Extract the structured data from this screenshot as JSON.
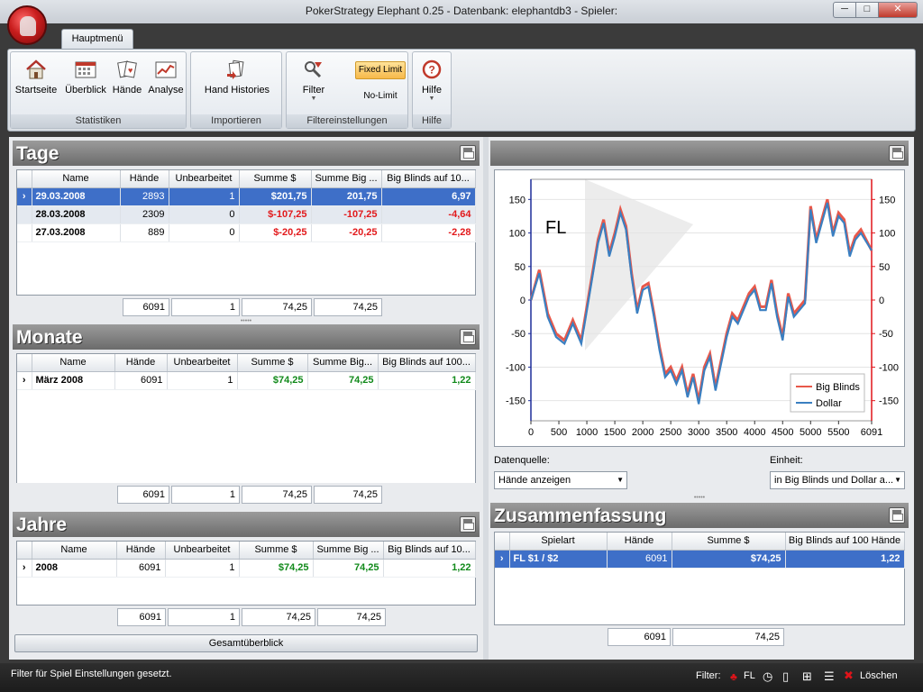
{
  "window": {
    "title": "PokerStrategy Elephant 0.25 - Datenbank: elephantdb3 - Spieler:",
    "min": "─",
    "max": "□",
    "close": "✕"
  },
  "ribbon": {
    "tab": "Hauptmenü",
    "groups": {
      "statistiken": "Statistiken",
      "importieren": "Importieren",
      "filter": "Filtereinstellungen",
      "hilfe": "Hilfe"
    },
    "buttons": {
      "startseite": "Startseite",
      "ueberblick": "Überblick",
      "haende": "Hände",
      "analyse": "Analyse",
      "hand_histories": "Hand Histories",
      "filter": "Filter",
      "fixed_limit": "Fixed Limit",
      "no_limit": "No-Limit",
      "hilfe": "Hilfe"
    }
  },
  "tage": {
    "title": "Tage",
    "columns": [
      "Name",
      "Hände",
      "Unbearbeitet",
      "Summe $",
      "Summe Big ...",
      "Big Blinds auf 10..."
    ],
    "rows": [
      {
        "name": "29.03.2008",
        "haende": "2893",
        "unbearbeitet": "1",
        "summe": "$201,75",
        "bb": "201,75",
        "bb100": "6,97"
      },
      {
        "name": "28.03.2008",
        "haende": "2309",
        "unbearbeitet": "0",
        "summe": "$-107,25",
        "bb": "-107,25",
        "bb100": "-4,64"
      },
      {
        "name": "27.03.2008",
        "haende": "889",
        "unbearbeitet": "0",
        "summe": "$-20,25",
        "bb": "-20,25",
        "bb100": "-2,28"
      }
    ],
    "totals": {
      "haende": "6091",
      "unbearbeitet": "1",
      "summe": "74,25",
      "bb": "74,25"
    }
  },
  "monate": {
    "title": "Monate",
    "columns": [
      "Name",
      "Hände",
      "Unbearbeitet",
      "Summe $",
      "Summe Big...",
      "Big Blinds auf 100..."
    ],
    "rows": [
      {
        "name": "März 2008",
        "haende": "6091",
        "unbearbeitet": "1",
        "summe": "$74,25",
        "bb": "74,25",
        "bb100": "1,22"
      }
    ],
    "totals": {
      "haende": "6091",
      "unbearbeitet": "1",
      "summe": "74,25",
      "bb": "74,25"
    }
  },
  "jahre": {
    "title": "Jahre",
    "columns": [
      "Name",
      "Hände",
      "Unbearbeitet",
      "Summe $",
      "Summe Big ...",
      "Big Blinds auf 10..."
    ],
    "rows": [
      {
        "name": "2008",
        "haende": "6091",
        "unbearbeitet": "1",
        "summe": "$74,25",
        "bb": "74,25",
        "bb100": "1,22"
      }
    ],
    "totals": {
      "haende": "6091",
      "unbearbeitet": "1",
      "summe": "74,25",
      "bb": "74,25"
    }
  },
  "gesamt_label": "Gesamtüberblick",
  "graph": {
    "datenquelle_label": "Datenquelle:",
    "datenquelle_value": "Hände anzeigen",
    "einheit_label": "Einheit:",
    "einheit_value": "in Big Blinds und Dollar a...",
    "colors": {
      "big_blinds": "#e8584a",
      "dollar": "#3a7fc1",
      "axis_right": "#e0141a",
      "axis_left": "#1f2f9a"
    }
  },
  "chart_data": {
    "type": "line",
    "annotation": "FL",
    "x_ticks": [
      "0",
      "500",
      "1000",
      "1500",
      "2000",
      "2500",
      "3000",
      "3500",
      "4000",
      "4500",
      "5000",
      "5500",
      "6091"
    ],
    "y_ticks_left": [
      "150",
      "100",
      "50",
      "0",
      "-50",
      "-100",
      "-150"
    ],
    "y_ticks_right": [
      "150",
      "100",
      "50",
      "0",
      "-50",
      "-100",
      "-150"
    ],
    "xlim": [
      0,
      6091
    ],
    "ylim": [
      -180,
      180
    ],
    "legend_position": "bottom-right",
    "series": [
      {
        "name": "Big Blinds",
        "x": [
          0,
          150,
          300,
          450,
          600,
          750,
          900,
          1000,
          1100,
          1200,
          1300,
          1400,
          1500,
          1600,
          1700,
          1800,
          1900,
          2000,
          2100,
          2200,
          2300,
          2400,
          2500,
          2600,
          2700,
          2800,
          2900,
          3000,
          3100,
          3200,
          3300,
          3400,
          3500,
          3600,
          3700,
          3800,
          3900,
          4000,
          4100,
          4200,
          4300,
          4400,
          4500,
          4600,
          4700,
          4800,
          4900,
          5000,
          5100,
          5200,
          5300,
          5400,
          5500,
          5600,
          5700,
          5800,
          5900,
          6091
        ],
        "values": [
          0,
          45,
          -20,
          -50,
          -60,
          -30,
          -60,
          -10,
          40,
          90,
          120,
          70,
          100,
          135,
          110,
          40,
          -15,
          20,
          25,
          -20,
          -70,
          -110,
          -100,
          -120,
          -100,
          -140,
          -110,
          -150,
          -100,
          -80,
          -130,
          -90,
          -50,
          -20,
          -30,
          -10,
          10,
          20,
          -10,
          -10,
          30,
          -20,
          -55,
          10,
          -20,
          -10,
          0,
          140,
          90,
          120,
          150,
          100,
          130,
          120,
          70,
          95,
          105,
          74
        ]
      },
      {
        "name": "Dollar",
        "x": [
          0,
          150,
          300,
          450,
          600,
          750,
          900,
          1000,
          1100,
          1200,
          1300,
          1400,
          1500,
          1600,
          1700,
          1800,
          1900,
          2000,
          2100,
          2200,
          2300,
          2400,
          2500,
          2600,
          2700,
          2800,
          2900,
          3000,
          3100,
          3200,
          3300,
          3400,
          3500,
          3600,
          3700,
          3800,
          3900,
          4000,
          4100,
          4200,
          4300,
          4400,
          4500,
          4600,
          4700,
          4800,
          4900,
          5000,
          5100,
          5200,
          5300,
          5400,
          5500,
          5600,
          5700,
          5800,
          5900,
          6091
        ],
        "values": [
          0,
          40,
          -25,
          -55,
          -65,
          -35,
          -65,
          -15,
          35,
          85,
          115,
          65,
          95,
          130,
          105,
          35,
          -20,
          15,
          20,
          -25,
          -75,
          -115,
          -105,
          -125,
          -105,
          -145,
          -115,
          -155,
          -105,
          -85,
          -135,
          -95,
          -55,
          -25,
          -35,
          -15,
          5,
          15,
          -15,
          -15,
          25,
          -25,
          -60,
          5,
          -25,
          -15,
          -5,
          135,
          85,
          115,
          145,
          95,
          125,
          115,
          65,
          90,
          100,
          74
        ]
      }
    ]
  },
  "zusammenfassung": {
    "title": "Zusammenfassung",
    "columns": [
      "Spielart",
      "Hände",
      "Summe $",
      "Big Blinds auf 100 Hände"
    ],
    "rows": [
      {
        "spielart": "FL $1 / $2",
        "haende": "6091",
        "summe": "$74,25",
        "bb100": "1,22"
      }
    ],
    "totals": {
      "haende": "6091",
      "summe": "74,25"
    }
  },
  "status": {
    "text": "Filter für Spiel Einstellungen gesetzt.",
    "filter_label": "Filter:",
    "fl_label": "FL",
    "loeschen_label": "Löschen"
  }
}
